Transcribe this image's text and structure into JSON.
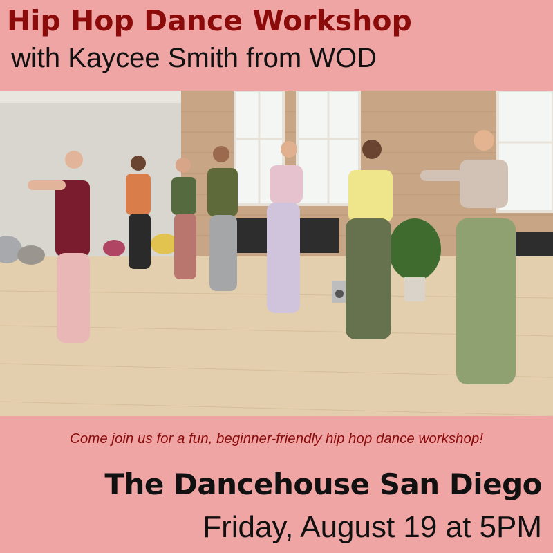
{
  "header": {
    "title": "Hip Hop Dance Workshop",
    "subtitle": "with Kaycee Smith from WOD"
  },
  "photo": {
    "subject": "dance-class-photo"
  },
  "footer": {
    "tagline": "Come join us for a fun, beginner-friendly hip hop dance workshop!",
    "venue": "The Dancehouse San Diego",
    "datetime": "Friday, August 19 at 5PM"
  },
  "colors": {
    "background": "#f0a5a5",
    "title": "#8b0b0b",
    "tagline": "#8b0b0b",
    "text": "#111111"
  }
}
